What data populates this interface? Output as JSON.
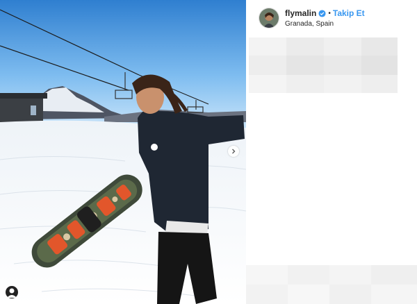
{
  "post": {
    "header": {
      "username": "flymalin",
      "separator": "•",
      "follow_label": "Takip Et",
      "location": "Granada, Spain"
    }
  },
  "icons": {
    "verified": "verified-badge-icon",
    "next": "chevron-right-icon"
  },
  "colors": {
    "follow": "#3897f0",
    "verified": "#3897f0",
    "text": "#262626"
  }
}
